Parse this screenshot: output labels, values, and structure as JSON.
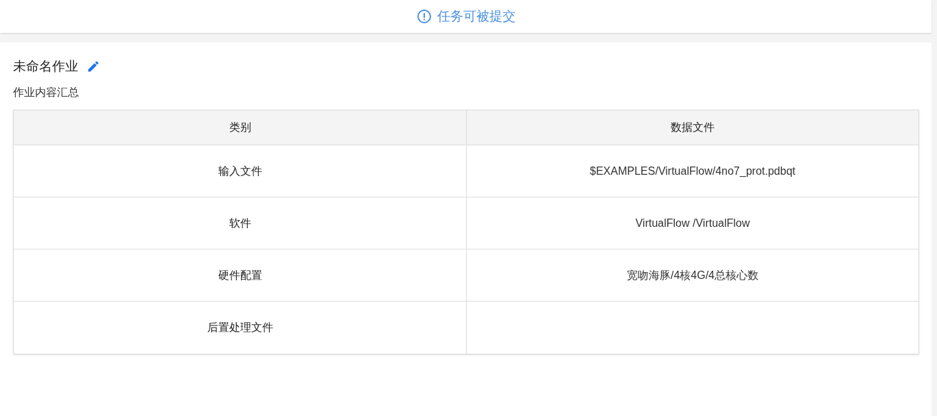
{
  "status_banner": {
    "text": "任务可被提交"
  },
  "job": {
    "title": "未命名作业",
    "section_label": "作业内容汇总"
  },
  "table": {
    "columns": [
      "类别",
      "数据文件"
    ],
    "rows": [
      {
        "category": "输入文件",
        "data_file": "$EXAMPLES/VirtualFlow/4no7_prot.pdbqt"
      },
      {
        "category": "软件",
        "data_file": "VirtualFlow /VirtualFlow"
      },
      {
        "category": "硬件配置",
        "data_file": "宽吻海豚/4核4G/4总核心数"
      },
      {
        "category": "后置处理文件"
      }
    ]
  }
}
